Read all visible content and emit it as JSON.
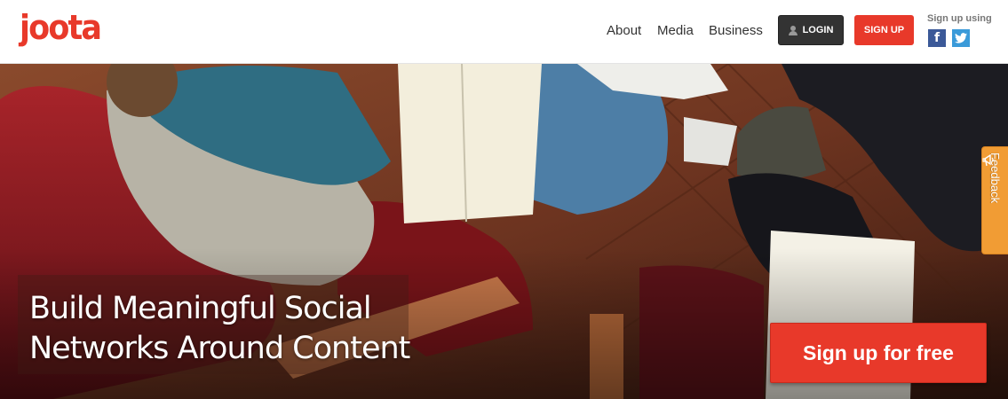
{
  "brand": {
    "logo_text": "joota",
    "color": "#e8392a"
  },
  "nav": {
    "items": [
      "About",
      "Media",
      "Business"
    ],
    "login_label": "LOGIN",
    "signup_label": "SIGN UP",
    "signup_using_label": "Sign up using",
    "facebook_glyph": "f"
  },
  "hero": {
    "headline_line1": "Build Meaningful Social",
    "headline_line2": "Networks Around Content",
    "cta_label": "Sign up for free"
  },
  "feedback": {
    "label": "Feedback"
  },
  "icons": {
    "login": "user-icon",
    "facebook": "facebook-icon",
    "twitter": "twitter-icon",
    "feedback": "megaphone-icon"
  },
  "colors": {
    "accent": "#e8392a",
    "dark_button": "#333333",
    "facebook": "#3b5998",
    "twitter": "#3a9ad9",
    "feedback": "#f19c34"
  }
}
